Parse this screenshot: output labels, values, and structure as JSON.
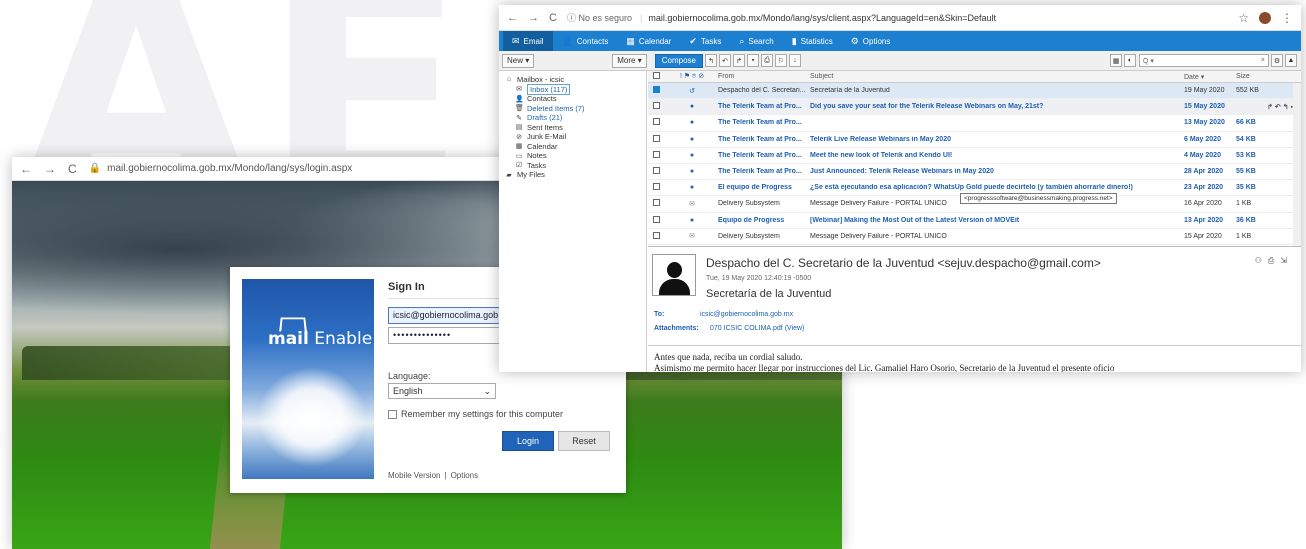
{
  "background_logo": "AE",
  "login_window": {
    "nav": {
      "back": "←",
      "forward": "→",
      "reload": "C"
    },
    "url": "mail.gobiernocolima.gob.mx/Mondo/lang/sys/login.aspx",
    "brand": {
      "mail": "mail",
      "enable": "Enable"
    },
    "title": "Sign In",
    "username_value": "icsic@gobiernocolima.gob.mx",
    "password_value": "••••••••••••••",
    "language_label": "Language:",
    "language_value": "English",
    "remember_label": "Remember my settings for this computer",
    "login_button": "Login",
    "reset_button": "Reset",
    "footer": {
      "mobile": "Mobile Version",
      "sep": "|",
      "options": "Options"
    }
  },
  "client_window": {
    "nav": {
      "back": "←",
      "forward": "→",
      "reload": "C"
    },
    "insecure_label": "ⓘ No es seguro",
    "url": "mail.gobiernocolima.gob.mx/Mondo/lang/sys/client.aspx?LanguageId=en&Skin=Default",
    "menu": [
      {
        "icon": "✉",
        "label": "Email"
      },
      {
        "icon": "👤",
        "label": "Contacts"
      },
      {
        "icon": "▦",
        "label": "Calendar"
      },
      {
        "icon": "✔",
        "label": "Tasks"
      },
      {
        "icon": "⌕",
        "label": "Search"
      },
      {
        "icon": "▮",
        "label": "Statistics"
      },
      {
        "icon": "⚙",
        "label": "Options"
      }
    ],
    "toolbar": {
      "new": "New",
      "more": "More",
      "compose": "Compose",
      "search_placeholder": "Q ▾"
    },
    "folders": {
      "root": "Mailbox - icsic",
      "items": [
        {
          "icon": "✉",
          "label": "Inbox (117)"
        },
        {
          "icon": "👤",
          "label": "Contacts"
        },
        {
          "icon": "🗑",
          "label": "Deleted Items (7)"
        },
        {
          "icon": "✎",
          "label": "Drafts (21)"
        },
        {
          "icon": "▤",
          "label": "Sent Items"
        },
        {
          "icon": "⊘",
          "label": "Junk E-Mail"
        },
        {
          "icon": "▦",
          "label": "Calendar"
        },
        {
          "icon": "▭",
          "label": "Notes"
        },
        {
          "icon": "☑",
          "label": "Tasks"
        }
      ],
      "files": "My Files"
    },
    "columns": {
      "from": "From",
      "subject": "Subject",
      "date": "Date",
      "size": "Size"
    },
    "messages": [
      {
        "icon": "↺",
        "from": "Despacho del C. Secretari...",
        "subject": "Secretaría de la Juventud",
        "date": "19 May 2020",
        "size": "552 KB"
      },
      {
        "icon": "●",
        "from": "The Telerik Team at Pro...",
        "subject": "Did you save your seat for the Telerik Release Webinars on May, 21st?",
        "date": "15 May 2020",
        "size": ""
      },
      {
        "icon": "●",
        "from": "The Telerik Team at Pro...",
        "subject": "",
        "date": "13 May 2020",
        "size": "66 KB"
      },
      {
        "icon": "●",
        "from": "The Telerik Team at Pro...",
        "subject": "Telerik Live Release Webinars in May 2020",
        "date": "6 May 2020",
        "size": "54 KB"
      },
      {
        "icon": "●",
        "from": "The Telerik Team at Pro...",
        "subject": "Meet the new look of Telerik and Kendo UI!",
        "date": "4 May 2020",
        "size": "53 KB"
      },
      {
        "icon": "●",
        "from": "The Telerik Team at Pro...",
        "subject": "Just Announced: Telerik Release Webinars in May 2020",
        "date": "28 Apr 2020",
        "size": "55 KB"
      },
      {
        "icon": "●",
        "from": "El equipo de Progress",
        "subject": "¿Se está ejecutando esa aplicación? WhatsUp Gold puede decírtelo (y también ahorrarle dinero!)",
        "date": "23 Apr 2020",
        "size": "35 KB"
      },
      {
        "icon": "✉",
        "from": "Delivery Subsystem",
        "subject": "Message Delivery Failure - PORTAL UNICO",
        "date": "16 Apr 2020",
        "size": "1 KB"
      },
      {
        "icon": "●",
        "from": "Equipo de Progress",
        "subject": "[Webinar] Making the Most Out of the Latest Version of MOVEit",
        "date": "13 Apr 2020",
        "size": "36 KB"
      },
      {
        "icon": "✉",
        "from": "Delivery Subsystem",
        "subject": "Message Delivery Failure - PORTAL UNICO",
        "date": "15 Apr 2020",
        "size": "1 KB"
      }
    ],
    "tooltip": "<progresssoftware@businessmaking.progress.net>",
    "preview": {
      "from": "Despacho del C. Secretario de la Juventud <sejuv.despacho@gmail.com>",
      "date": "Tue, 19 May 2020 12:40:19 -0500",
      "subject": "Secretaría de la Juventud",
      "to_label": "To:",
      "to_value": "icsic@gobiernocolima.gob.mx",
      "attachments_label": "Attachments:",
      "attachments_value": "070 ICSIC COLIMA.pdf (View)",
      "body_line1": "Antes que nada, reciba un cordial saludo.",
      "body_line2": "Asimismo me permito hacer llegar por instrucciones del Lic. Gamaliel Haro Osorio, Secretario de la Juventud el presente oficio"
    }
  }
}
